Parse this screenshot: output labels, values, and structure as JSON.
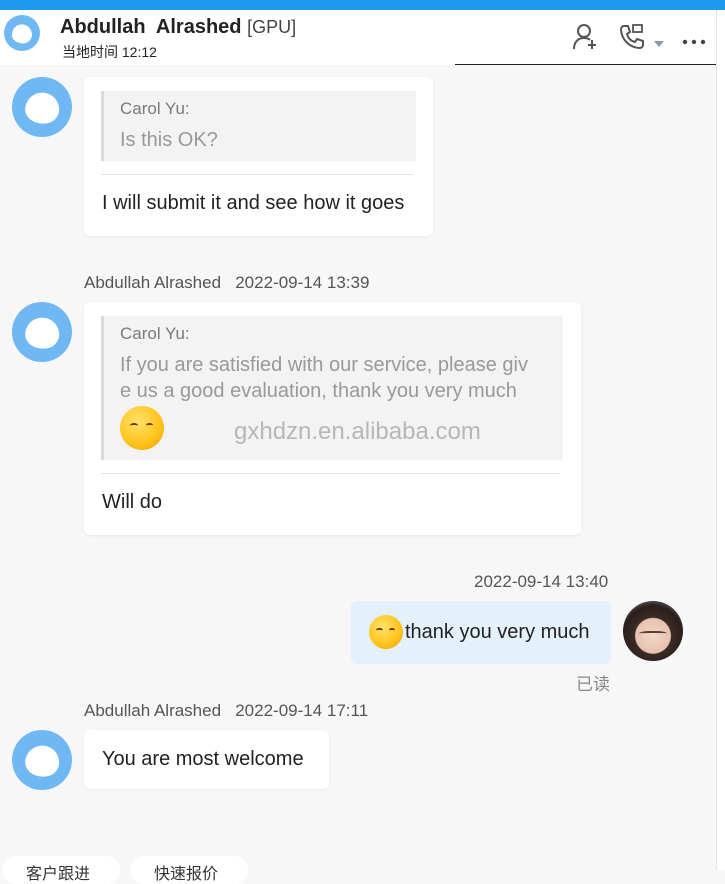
{
  "header": {
    "contact_name": "Abdullah  Alrashed",
    "contact_tag": "[GPU]",
    "local_time_label": "当地时间 12:12",
    "icons": [
      "add-contact-icon",
      "call-icon",
      "dropdown-icon",
      "more-icon"
    ]
  },
  "messages": [
    {
      "quote_author": "Carol Yu:",
      "quote_text": "Is this OK?",
      "text": "I will submit it and see how it goes"
    },
    {
      "sender": "Abdullah Alrashed",
      "time": "2022-09-14 13:39",
      "quote_author": "Carol Yu:",
      "quote_line1": "If you are satisfied with our service, please giv",
      "quote_line2": "e us a good evaluation, thank you very much",
      "quote_emoji": "blushing-emoji",
      "watermark": "gxhdzn.en.alibaba.com",
      "text": "Will do"
    },
    {
      "time": "2022-09-14 13:40",
      "emoji": "thinking-emoji",
      "text": "thank you very much",
      "status": "已读"
    },
    {
      "sender": "Abdullah Alrashed",
      "time": "2022-09-14 17:11",
      "text": "You are most welcome"
    }
  ],
  "quick_actions": [
    "客户跟进",
    "快速报价"
  ],
  "colors": {
    "accent": "#1e9bf0",
    "avatar": "#70b8f3",
    "outgoing_bubble": "#e4f0fc"
  }
}
